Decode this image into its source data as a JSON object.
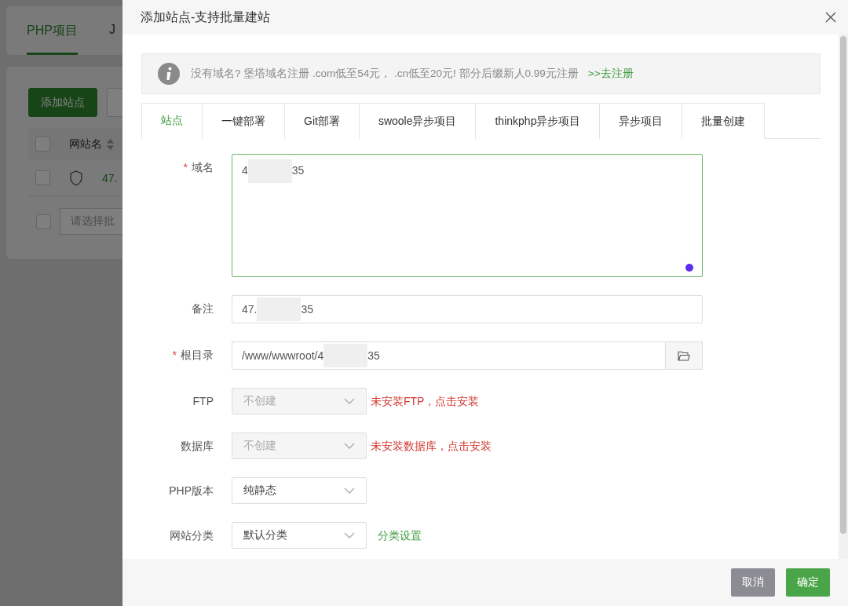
{
  "background": {
    "tabs": [
      {
        "label": "PHP项目",
        "selected": true
      },
      {
        "label": "J",
        "selected": false
      }
    ],
    "buttons": [
      {
        "label": "添加站点",
        "kind": "primary"
      },
      {
        "kind": "plain"
      }
    ],
    "table": {
      "select_all": {
        "checked": false
      },
      "columns": [
        "网站名"
      ],
      "rows": [
        {
          "checked": false,
          "site": "47."
        }
      ]
    },
    "batch_select": {
      "checked": false,
      "placeholder": "请选择批"
    }
  },
  "dialog": {
    "title": "添加站点-支持批量建站",
    "notice": {
      "text": "没有域名? 堡塔域名注册 .com低至54元，  .cn低至20元! 部分后缀新人0.99元注册",
      "link": ">>去注册"
    },
    "tabs": [
      {
        "label": "站点",
        "selected": true
      },
      {
        "label": "一键部署",
        "selected": false
      },
      {
        "label": "Git部署",
        "selected": false
      },
      {
        "label": "swoole异步项目",
        "selected": false
      },
      {
        "label": "thinkphp异步项目",
        "selected": false
      },
      {
        "label": "异步项目",
        "selected": false
      },
      {
        "label": "批量创建",
        "selected": false
      }
    ],
    "fields": [
      {
        "kind": "textarea",
        "required_mark": "*",
        "label": "域名",
        "value_parts": [
          "4",
          "35"
        ]
      },
      {
        "kind": "input",
        "label": "备注",
        "value_parts": [
          "47.",
          "35"
        ]
      },
      {
        "kind": "path",
        "required_mark": "*",
        "label": "根目录",
        "value_parts": [
          "/www/wwwroot/4",
          "35"
        ]
      },
      {
        "kind": "select",
        "label": "FTP",
        "value": "不创建",
        "disabled": true,
        "note": {
          "kind": "error",
          "text": "未安装FTP，点击安装"
        }
      },
      {
        "kind": "select",
        "label": "数据库",
        "value": "不创建",
        "disabled": true,
        "note": {
          "kind": "error",
          "text": "未安装数据库，点击安装"
        }
      },
      {
        "kind": "select",
        "label": "PHP版本",
        "value": "纯静态",
        "disabled": false
      },
      {
        "kind": "select",
        "label": "网站分类",
        "value": "默认分类",
        "disabled": false,
        "note": {
          "kind": "link",
          "text": "分类设置"
        }
      }
    ],
    "buttons": [
      {
        "label": "取消",
        "kind": "secondary"
      },
      {
        "label": "确定",
        "kind": "primary"
      }
    ]
  }
}
